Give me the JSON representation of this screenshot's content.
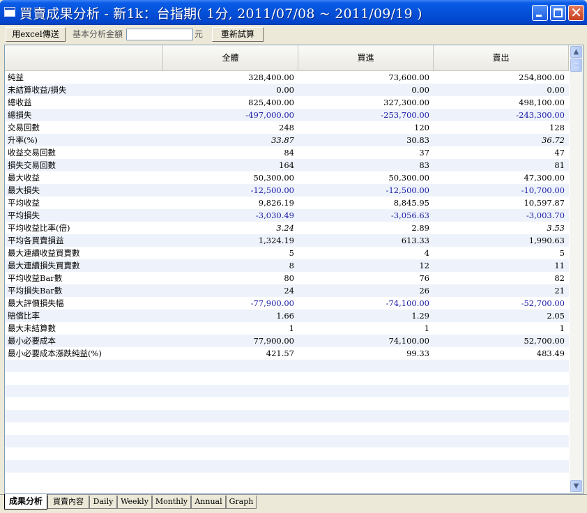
{
  "window": {
    "title": "買賣成果分析 - 新1k：台指期( 1分, 2011/07/08 ~ 2011/09/19 )"
  },
  "toolbar": {
    "excel_button": "用excel傳送",
    "amount_label": "基本分析金額",
    "amount_value": "",
    "unit_label": "元",
    "recalc_button": "重新試算"
  },
  "table": {
    "headers": [
      "",
      "全體",
      "買進",
      "賣出"
    ],
    "rows": [
      {
        "label": "純益",
        "all": "328,400.00",
        "buy": "73,600.00",
        "sell": "254,800.00"
      },
      {
        "label": "未結算收益/損失",
        "all": "0.00",
        "buy": "0.00",
        "sell": "0.00"
      },
      {
        "label": "總收益",
        "all": "825,400.00",
        "buy": "327,300.00",
        "sell": "498,100.00"
      },
      {
        "label": "總損失",
        "all": "-497,000.00",
        "buy": "-253,700.00",
        "sell": "-243,300.00"
      },
      {
        "label": "交易回數",
        "all": "248",
        "buy": "120",
        "sell": "128"
      },
      {
        "label": "升率(%)",
        "all": "33.87",
        "buy": "30.83",
        "sell": "36.72"
      },
      {
        "label": "收益交易回數",
        "all": "84",
        "buy": "37",
        "sell": "47"
      },
      {
        "label": "損失交易回數",
        "all": "164",
        "buy": "83",
        "sell": "81"
      },
      {
        "label": "最大收益",
        "all": "50,300.00",
        "buy": "50,300.00",
        "sell": "47,300.00"
      },
      {
        "label": "最大損失",
        "all": "-12,500.00",
        "buy": "-12,500.00",
        "sell": "-10,700.00"
      },
      {
        "label": "平均收益",
        "all": "9,826.19",
        "buy": "8,845.95",
        "sell": "10,597.87"
      },
      {
        "label": "平均損失",
        "all": "-3,030.49",
        "buy": "-3,056.63",
        "sell": "-3,003.70"
      },
      {
        "label": "平均收益比率(倍)",
        "all": "3.24",
        "buy": "2.89",
        "sell": "3.53"
      },
      {
        "label": "平均各買賣損益",
        "all": "1,324.19",
        "buy": "613.33",
        "sell": "1,990.63"
      },
      {
        "label": "最大連續收益買賣數",
        "all": "5",
        "buy": "4",
        "sell": "5"
      },
      {
        "label": "最大連續損失買賣數",
        "all": "8",
        "buy": "12",
        "sell": "11"
      },
      {
        "label": "平均收益Bar數",
        "all": "80",
        "buy": "76",
        "sell": "82"
      },
      {
        "label": "平均損失Bar數",
        "all": "24",
        "buy": "26",
        "sell": "21"
      },
      {
        "label": "最大評價損失幅",
        "all": "-77,900.00",
        "buy": "-74,100.00",
        "sell": "-52,700.00"
      },
      {
        "label": "賠償比率",
        "all": "1.66",
        "buy": "1.29",
        "sell": "2.05"
      },
      {
        "label": "最大未結算數",
        "all": "1",
        "buy": "1",
        "sell": "1"
      },
      {
        "label": "最小必要成本",
        "all": "77,900.00",
        "buy": "74,100.00",
        "sell": "52,700.00"
      },
      {
        "label": "最小必要成本漲跌純益(%)",
        "all": "421.57",
        "buy": "99.33",
        "sell": "483.49"
      }
    ]
  },
  "tabs": [
    "成果分析",
    "買賣內容",
    "Daily",
    "Weekly",
    "Monthly",
    "Annual",
    "Graph"
  ],
  "colors": {
    "negative": "#1a1aa6",
    "stripe": "#eef3fb",
    "title_bar": "#0450d8"
  }
}
